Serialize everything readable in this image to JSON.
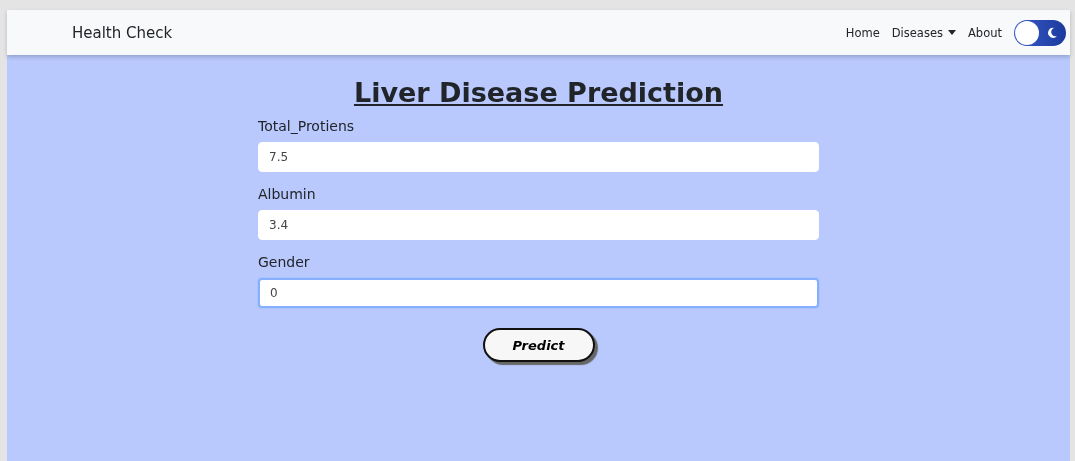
{
  "navbar": {
    "brand": "Health Check",
    "links": [
      {
        "label": "Home",
        "kind": "link"
      },
      {
        "label": "Diseases",
        "kind": "dropdown"
      },
      {
        "label": "About",
        "kind": "link"
      }
    ],
    "theme_toggle": {
      "on": false
    }
  },
  "title": "Liver Disease Prediction",
  "fields": [
    {
      "label": "Total_Protiens",
      "value": "7.5",
      "focused": false
    },
    {
      "label": "Albumin",
      "value": "3.4",
      "focused": false
    },
    {
      "label": "Gender",
      "value": "0",
      "focused": true
    }
  ],
  "button": "Predict"
}
